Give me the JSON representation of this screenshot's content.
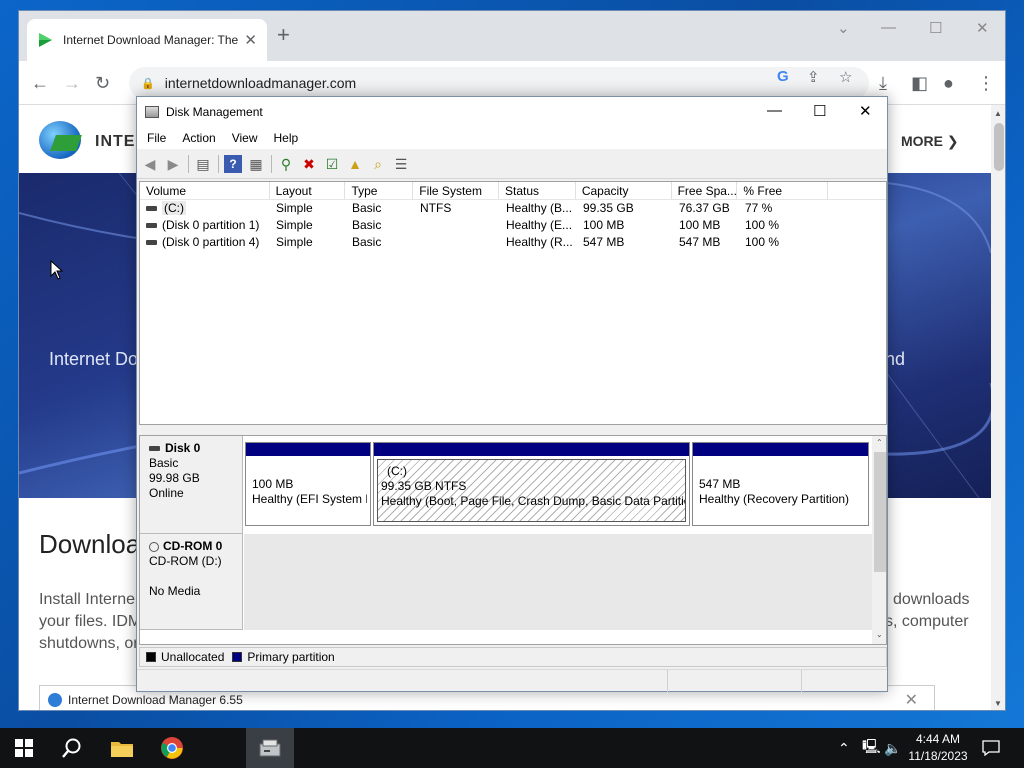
{
  "browser": {
    "tab_title": "Internet Download Manager: The",
    "url": "internetdownloadmanager.com"
  },
  "website": {
    "brand_partial": "INTER",
    "more_label": "MORE",
    "hero_text_left": "Internet Do",
    "hero_text_right": "nd",
    "heading_partial": "Downloa",
    "para_line1_left": "Install Interne",
    "para_line2_left": "your files. IDM",
    "para_line3_left": "shutdowns, or",
    "para_line1_right": "downloads",
    "para_line2_right": "s, computer",
    "bottom_box_text": "Internet Download Manager 6.55"
  },
  "disk_mgmt": {
    "title": "Disk Management",
    "menu": [
      "File",
      "Action",
      "View",
      "Help"
    ],
    "columns": [
      "Volume",
      "Layout",
      "Type",
      "File System",
      "Status",
      "Capacity",
      "Free Spa...",
      "% Free"
    ],
    "volumes": [
      {
        "volume": "(C:)",
        "layout": "Simple",
        "type": "Basic",
        "fs": "NTFS",
        "status": "Healthy (B...",
        "capacity": "99.35 GB",
        "free": "76.37 GB",
        "pct": "77 %"
      },
      {
        "volume": "(Disk 0 partition 1)",
        "layout": "Simple",
        "type": "Basic",
        "fs": "",
        "status": "Healthy (E...",
        "capacity": "100 MB",
        "free": "100 MB",
        "pct": "100 %"
      },
      {
        "volume": "(Disk 0 partition 4)",
        "layout": "Simple",
        "type": "Basic",
        "fs": "",
        "status": "Healthy (R...",
        "capacity": "547 MB",
        "free": "547 MB",
        "pct": "100 %"
      }
    ],
    "disk0": {
      "name": "Disk 0",
      "type": "Basic",
      "size": "99.98 GB",
      "state": "Online",
      "partitions": [
        {
          "name": "",
          "size": "100 MB",
          "status": "Healthy (EFI System P"
        },
        {
          "name": "(C:)",
          "size": "99.35 GB NTFS",
          "status": "Healthy (Boot, Page File, Crash Dump, Basic Data Partitior"
        },
        {
          "name": "",
          "size": "547 MB",
          "status": "Healthy (Recovery Partition)"
        }
      ]
    },
    "cdrom": {
      "name": "CD-ROM 0",
      "drive": "CD-ROM (D:)",
      "media": "No Media"
    },
    "legend": {
      "unallocated": "Unallocated",
      "primary": "Primary partition",
      "unallocated_color": "#000000",
      "primary_color": "#000080"
    }
  },
  "taskbar": {
    "time": "4:44 AM",
    "date": "11/18/2023"
  }
}
